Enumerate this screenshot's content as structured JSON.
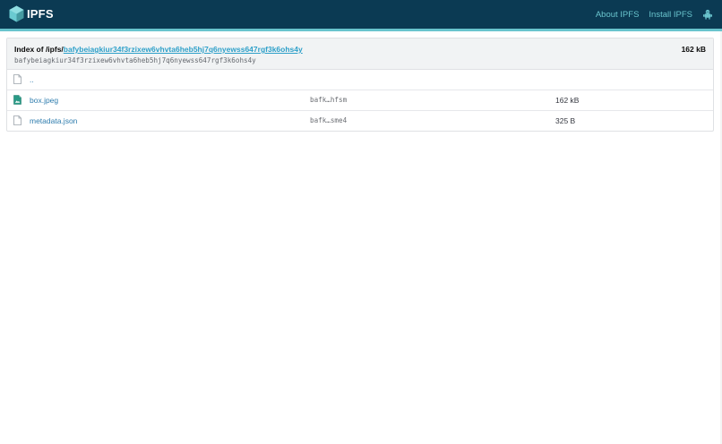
{
  "header": {
    "logo_text": "IPFS",
    "nav": [
      {
        "label": "About IPFS"
      },
      {
        "label": "Install IPFS"
      }
    ]
  },
  "listing": {
    "index_prefix": "Index of /ipfs/",
    "cid": "bafybeiagkiur34f3rzixew6vhvta6heb5hj7q6nyewss647rgf3k6ohs4y",
    "cid_mono": "bafybeiagkiur34f3rzixew6vhvta6heb5hj7q6nyewss647rgf3k6ohs4y",
    "total_size": "162 kB",
    "parent_link": "..",
    "files": [
      {
        "name": "box.jpeg",
        "hash": "bafk…hfsm",
        "size": "162 kB",
        "icon": "image-file-icon"
      },
      {
        "name": "metadata.json",
        "hash": "bafk…sme4",
        "size": "325 B",
        "icon": "file-icon"
      }
    ]
  },
  "colors": {
    "header_bg": "#0b3a53",
    "accent": "#69c4cd",
    "link": "#2f7dae",
    "cid_link": "#2ea0c9"
  }
}
